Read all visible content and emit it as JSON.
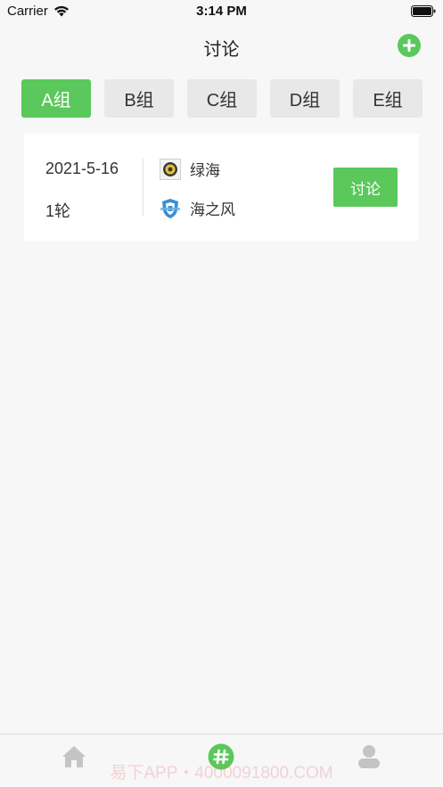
{
  "status_bar": {
    "carrier": "Carrier",
    "time": "3:14 PM",
    "icons": [
      "wifi-icon",
      "battery-icon"
    ]
  },
  "nav": {
    "title": "讨论",
    "add_icon": "plus-circle-icon",
    "accent_color": "#5ac85a"
  },
  "tabs": [
    {
      "label": "A组",
      "active": true
    },
    {
      "label": "B组",
      "active": false
    },
    {
      "label": "C组",
      "active": false
    },
    {
      "label": "D组",
      "active": false
    },
    {
      "label": "E组",
      "active": false
    }
  ],
  "match": {
    "date": "2021-5-16",
    "round": "1轮",
    "home_team": {
      "name": "绿海",
      "logo_icon": "team-badge-icon"
    },
    "away_team": {
      "name": "海之风",
      "logo_icon": "team-shield-icon"
    },
    "discuss_label": "讨论"
  },
  "tab_bar": {
    "items": [
      {
        "icon": "home-icon",
        "active": false
      },
      {
        "icon": "hashtag-icon",
        "active": true
      },
      {
        "icon": "user-icon",
        "active": false
      }
    ],
    "watermark": "易下APP・4000091800.COM"
  }
}
